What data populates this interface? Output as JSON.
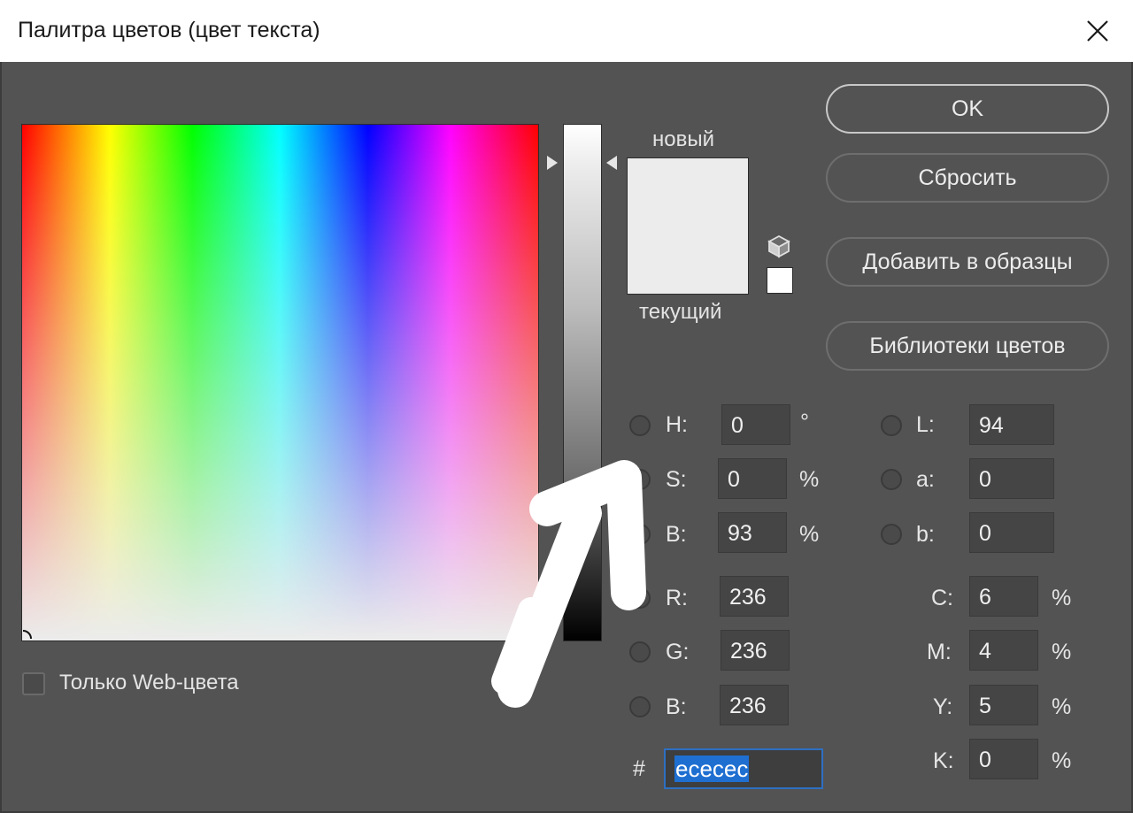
{
  "window": {
    "title": "Палитра цветов (цвет текста)",
    "close_icon": "close-icon"
  },
  "preview": {
    "new_label": "новый",
    "current_label": "текущий",
    "new_color": "#ececec",
    "current_color": "#ececec",
    "web_safe_color": "#ffffff"
  },
  "buttons": {
    "ok": "OK",
    "reset": "Сбросить",
    "add_to_swatches": "Добавить в образцы",
    "color_libraries": "Библиотеки цветов"
  },
  "hsb": {
    "h": {
      "label": "H:",
      "value": "0",
      "unit": "°"
    },
    "s": {
      "label": "S:",
      "value": "0",
      "unit": "%"
    },
    "b": {
      "label": "B:",
      "value": "93",
      "unit": "%"
    }
  },
  "rgb": {
    "r": {
      "label": "R:",
      "value": "236"
    },
    "g": {
      "label": "G:",
      "value": "236"
    },
    "b": {
      "label": "B:",
      "value": "236"
    }
  },
  "lab": {
    "l": {
      "label": "L:",
      "value": "94"
    },
    "a": {
      "label": "a:",
      "value": "0"
    },
    "b": {
      "label": "b:",
      "value": "0"
    }
  },
  "cmyk": {
    "c": {
      "label": "C:",
      "value": "6",
      "unit": "%"
    },
    "m": {
      "label": "M:",
      "value": "4",
      "unit": "%"
    },
    "y": {
      "label": "Y:",
      "value": "5",
      "unit": "%"
    },
    "k": {
      "label": "K:",
      "value": "0",
      "unit": "%"
    }
  },
  "hex": {
    "label": "#",
    "value": "ececec"
  },
  "web_only": {
    "label": "Только Web-цвета",
    "checked": false
  },
  "colors": {
    "dialog_bg": "#535353",
    "button_border": "#c8c8c8",
    "selection": "#1f6fd1"
  }
}
